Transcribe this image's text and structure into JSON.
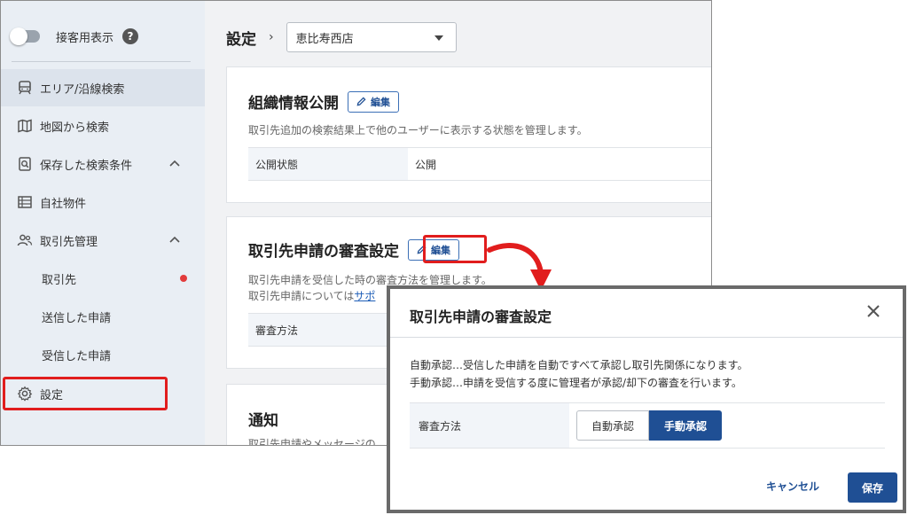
{
  "sidebar": {
    "toggle_label": "接客用表示",
    "help_glyph": "?",
    "items": [
      {
        "label": "エリア/沿線検索"
      },
      {
        "label": "地図から検索"
      },
      {
        "label": "保存した検索条件"
      },
      {
        "label": "自社物件"
      },
      {
        "label": "取引先管理"
      },
      {
        "label": "取引先"
      },
      {
        "label": "送信した申請"
      },
      {
        "label": "受信した申請"
      },
      {
        "label": "設定"
      }
    ]
  },
  "header": {
    "title": "設定",
    "separator": "›",
    "store_select_value": "恵比寿西店"
  },
  "org_card": {
    "title": "組織情報公開",
    "edit_label": "編集",
    "description": "取引先追加の検索結果上で他のユーザーに表示する状態を管理します。",
    "row_key": "公開状態",
    "row_value": "公開"
  },
  "review_card": {
    "title": "取引先申請の審査設定",
    "edit_label": "編集",
    "desc_line1": "取引先申請を受信した時の審査方法を管理します。",
    "desc_line2_prefix": "取引先申請については",
    "desc_line2_link": "サポ",
    "row_key": "審査方法"
  },
  "notice_card": {
    "title": "通知",
    "description": "取引先申請やメッセージの"
  },
  "modal": {
    "title": "取引先申請の審査設定",
    "desc_line1": "自動承認…受信した申請を自動ですべて承認し取引先関係になります。",
    "desc_line2": "手動承認…申請を受信する度に管理者が承認/却下の審査を行います。",
    "row_key": "審査方法",
    "option_auto": "自動承認",
    "option_manual": "手動承認",
    "selected": "手動承認",
    "cancel_label": "キャンセル",
    "save_label": "保存"
  },
  "colors": {
    "accent": "#1f4f94",
    "highlight_red": "#e11d1d",
    "sidebar_bg": "#e9eef4"
  }
}
